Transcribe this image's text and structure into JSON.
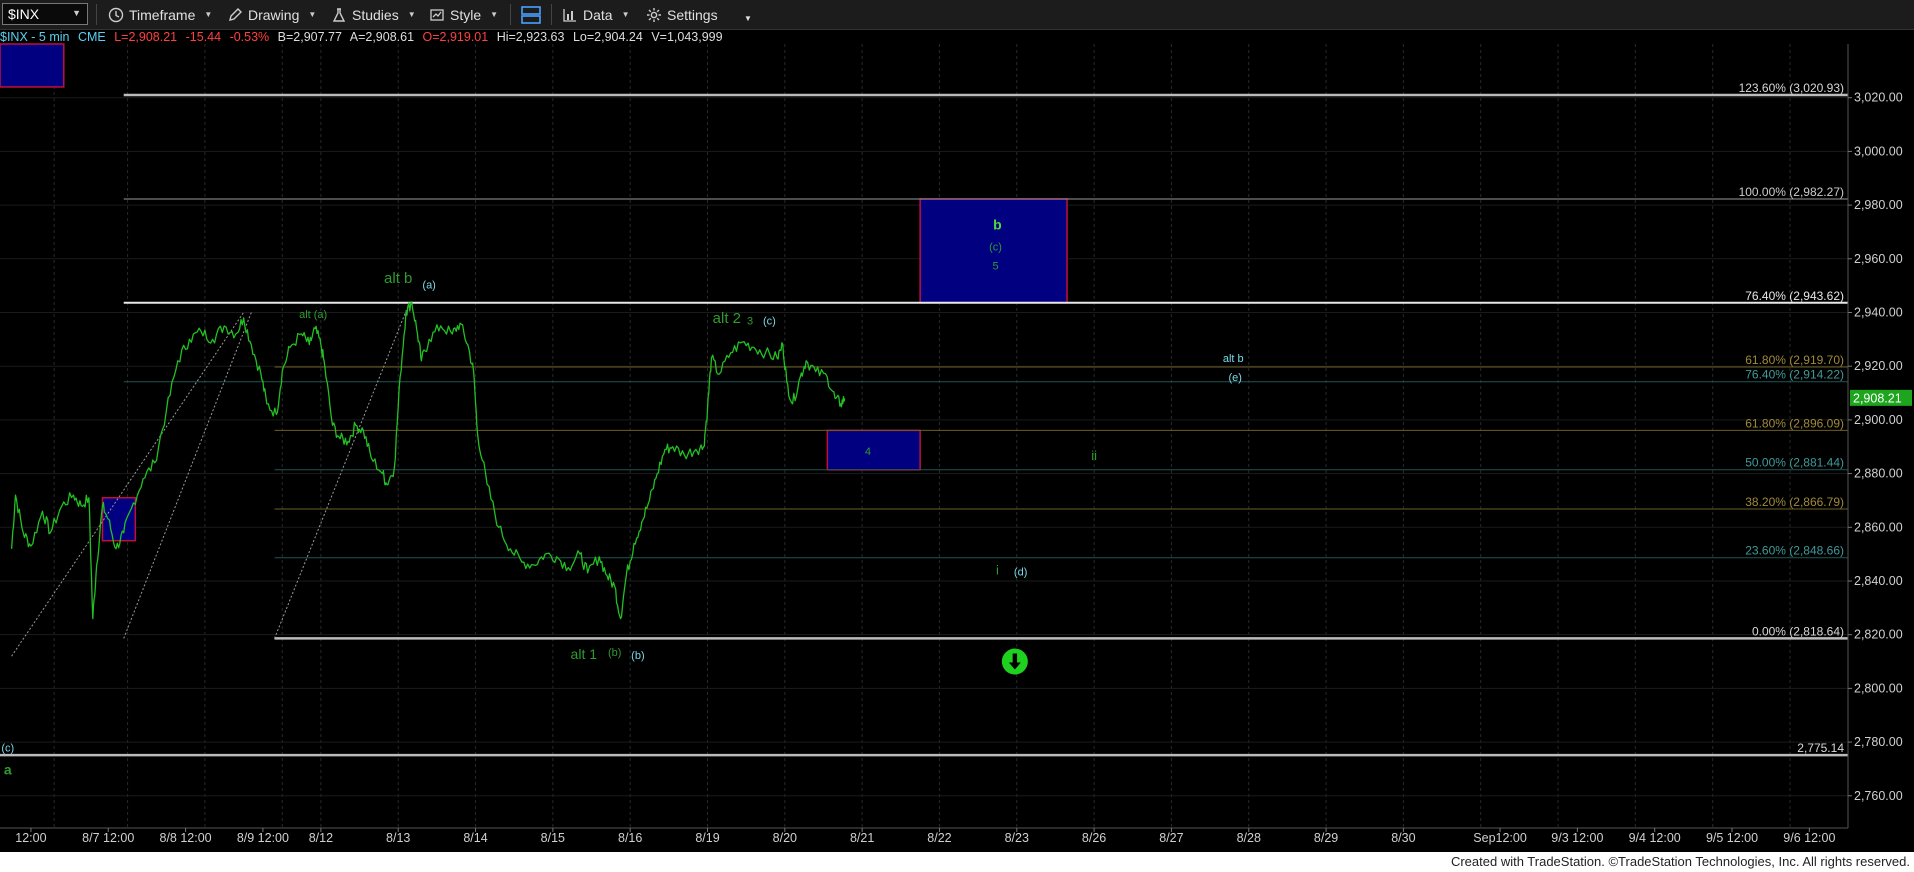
{
  "toolbar": {
    "symbol": "$INX",
    "timeframe_label": "Timeframe",
    "drawing_label": "Drawing",
    "studies_label": "Studies",
    "style_label": "Style",
    "data_label": "Data",
    "settings_label": "Settings"
  },
  "info": {
    "symbol_interval": "$INX - 5 min",
    "exchange": "CME",
    "last": "L=2,908.21",
    "change": "-15.44",
    "change_pct": "-0.53%",
    "bid": "B=2,907.77",
    "ask": "A=2,908.61",
    "open": "O=2,919.01",
    "high": "Hi=2,923.63",
    "low": "Lo=2,904.24",
    "volume": "V=1,043,999"
  },
  "colors": {
    "up": "#4ade3a",
    "down": "#ff3b3b",
    "price": "#22c022",
    "wave_green": "#2f9b2f",
    "wave_cyan": "#7ad8e8",
    "box_fill": "#000080",
    "box_border": "#c0103a",
    "fib_gold": "#a08a3a",
    "fib_teal": "#2a6a6a",
    "last_price_bg": "#1ea51e"
  },
  "chart_data": {
    "type": "line",
    "symbol": "$INX",
    "interval": "5 min",
    "ylim": [
      2748,
      3040
    ],
    "y_ticks": [
      "3,020.00",
      "3,000.00",
      "2,980.00",
      "2,960.00",
      "2,940.00",
      "2,920.00",
      "2,900.00",
      "2,880.00",
      "2,860.00",
      "2,840.00",
      "2,820.00",
      "2,800.00",
      "2,780.00",
      "2,760.00"
    ],
    "y_tick_values": [
      3020,
      3000,
      2980,
      2960,
      2940,
      2920,
      2900,
      2880,
      2860,
      2840,
      2820,
      2800,
      2780,
      2760
    ],
    "x_ticks": [
      "12:00",
      "8/7 12:00",
      "8/8 12:00",
      "8/9 12:00",
      "8/12",
      "8/13",
      "8/14",
      "8/15",
      "8/16",
      "8/19",
      "8/20",
      "8/21",
      "8/22",
      "8/23",
      "8/26",
      "8/27",
      "8/28",
      "8/29",
      "8/30",
      "Sep12:00",
      "9/3 12:00",
      "9/4 12:00",
      "9/5 12:00",
      "9/6 12:00"
    ],
    "x_tick_index": [
      0.5,
      2.5,
      4.5,
      6.5,
      8,
      10,
      12,
      14,
      16,
      18,
      20,
      22,
      24,
      26,
      28,
      30,
      32,
      34,
      36,
      38.5,
      40.5,
      42.5,
      44.5,
      46.5
    ],
    "x_range": [
      -0.3,
      47.5
    ],
    "session_starts": [
      1.1,
      3,
      5,
      7,
      8,
      10,
      12,
      14,
      16,
      18,
      20,
      22,
      24,
      26,
      28,
      30,
      32,
      34,
      36,
      38,
      40,
      42,
      44,
      46
    ],
    "series": [
      {
        "values": [
          [
            0.0,
            2852
          ],
          [
            0.1,
            2872
          ],
          [
            0.3,
            2858
          ],
          [
            0.5,
            2853
          ],
          [
            0.8,
            2866
          ],
          [
            1.0,
            2858
          ],
          [
            1.3,
            2868
          ],
          [
            1.6,
            2872
          ],
          [
            1.8,
            2868
          ],
          [
            2.0,
            2871
          ],
          [
            2.1,
            2826
          ],
          [
            2.2,
            2846
          ],
          [
            2.35,
            2868
          ],
          [
            2.5,
            2863
          ],
          [
            2.7,
            2852
          ],
          [
            2.9,
            2858
          ],
          [
            3.1,
            2867
          ],
          [
            3.4,
            2878
          ],
          [
            3.7,
            2884
          ],
          [
            4.0,
            2903
          ],
          [
            4.3,
            2922
          ],
          [
            4.6,
            2930
          ],
          [
            4.9,
            2933
          ],
          [
            5.2,
            2930
          ],
          [
            5.5,
            2935
          ],
          [
            5.8,
            2932
          ],
          [
            6.0,
            2938
          ],
          [
            6.2,
            2928
          ],
          [
            6.45,
            2917
          ],
          [
            6.6,
            2906
          ],
          [
            6.85,
            2902
          ],
          [
            7.0,
            2918
          ],
          [
            7.2,
            2927
          ],
          [
            7.5,
            2932
          ],
          [
            7.7,
            2928
          ],
          [
            7.85,
            2934
          ],
          [
            8.0,
            2928
          ],
          [
            8.1,
            2920
          ],
          [
            8.3,
            2898
          ],
          [
            8.5,
            2893
          ],
          [
            8.7,
            2892
          ],
          [
            8.9,
            2898
          ],
          [
            9.1,
            2896
          ],
          [
            9.3,
            2886
          ],
          [
            9.6,
            2880
          ],
          [
            9.7,
            2876
          ],
          [
            9.9,
            2882
          ],
          [
            10.05,
            2916
          ],
          [
            10.2,
            2940
          ],
          [
            10.35,
            2944
          ],
          [
            10.5,
            2932
          ],
          [
            10.6,
            2922
          ],
          [
            10.8,
            2930
          ],
          [
            11.1,
            2935
          ],
          [
            11.4,
            2932
          ],
          [
            11.6,
            2936
          ],
          [
            11.8,
            2928
          ],
          [
            11.95,
            2918
          ],
          [
            12.05,
            2895
          ],
          [
            12.3,
            2876
          ],
          [
            12.6,
            2860
          ],
          [
            12.9,
            2852
          ],
          [
            13.2,
            2847
          ],
          [
            13.5,
            2846
          ],
          [
            13.8,
            2850
          ],
          [
            14.1,
            2849
          ],
          [
            14.4,
            2845
          ],
          [
            14.7,
            2850
          ],
          [
            14.9,
            2843
          ],
          [
            15.2,
            2849
          ],
          [
            15.4,
            2842
          ],
          [
            15.6,
            2838
          ],
          [
            15.75,
            2826
          ],
          [
            15.9,
            2842
          ],
          [
            16.1,
            2854
          ],
          [
            16.3,
            2862
          ],
          [
            16.5,
            2870
          ],
          [
            16.7,
            2880
          ],
          [
            16.9,
            2889
          ],
          [
            17.1,
            2890
          ],
          [
            17.4,
            2887
          ],
          [
            17.7,
            2889
          ],
          [
            17.9,
            2890
          ],
          [
            18.0,
            2904
          ],
          [
            18.1,
            2923
          ],
          [
            18.3,
            2917
          ],
          [
            18.6,
            2925
          ],
          [
            18.9,
            2929
          ],
          [
            19.2,
            2927
          ],
          [
            19.5,
            2925
          ],
          [
            19.8,
            2923
          ],
          [
            19.95,
            2928
          ],
          [
            20.05,
            2914
          ],
          [
            20.2,
            2906
          ],
          [
            20.4,
            2916
          ],
          [
            20.55,
            2922
          ],
          [
            20.8,
            2918
          ],
          [
            21.1,
            2916
          ],
          [
            21.3,
            2908
          ],
          [
            21.45,
            2906
          ],
          [
            21.55,
            2908
          ]
        ]
      }
    ],
    "fib_levels": [
      {
        "label": "123.60% (3,020.93)",
        "value": 3021,
        "style": "major"
      },
      {
        "label": "100.00% (2,982.27)",
        "value": 2982.27,
        "style": "minor_gray"
      },
      {
        "label": "76.40% (2,943.62)",
        "value": 2943.62,
        "style": "major_white"
      },
      {
        "label": "61.80% (2,919.70)",
        "value": 2919.7,
        "style": "gold"
      },
      {
        "label": "76.40% (2,914.22)",
        "value": 2914.22,
        "style": "teal"
      },
      {
        "label": "61.80% (2,896.09)",
        "value": 2896.09,
        "style": "gold"
      },
      {
        "label": "50.00% (2,881.44)",
        "value": 2881.44,
        "style": "teal"
      },
      {
        "label": "38.20% (2,866.79)",
        "value": 2866.79,
        "style": "gold"
      },
      {
        "label": "23.60% (2,848.66)",
        "value": 2848.66,
        "style": "teal"
      },
      {
        "label": "0.00% (2,818.64)",
        "value": 2818.64,
        "style": "major"
      },
      {
        "label": "2,775.14",
        "value": 2775.14,
        "style": "major"
      }
    ],
    "fib_start_index": [
      2.9,
      2.9,
      2.9,
      6.8,
      2.9,
      6.8,
      6.8,
      6.8,
      6.8,
      6.8,
      -0.3
    ],
    "zones": [
      {
        "x": [
          23.5,
          27.3
        ],
        "y": [
          2943.6,
          2982.3
        ]
      },
      {
        "x": [
          21.1,
          23.5
        ],
        "y": [
          2881.4,
          2896.1
        ]
      },
      {
        "x": [
          2.35,
          3.2
        ],
        "y": [
          2855,
          2871
        ]
      },
      {
        "x": [
          -0.3,
          1.35
        ],
        "y": [
          3024,
          3040
        ]
      }
    ],
    "trendlines": [
      {
        "from": [
          0.0,
          2812
        ],
        "to": [
          6.0,
          2940
        ]
      },
      {
        "from": [
          2.9,
          2818.6
        ],
        "to": [
          6.2,
          2940
        ]
      },
      {
        "from": [
          6.8,
          2818.6
        ],
        "to": [
          10.3,
          2944
        ]
      }
    ],
    "annotations": [
      {
        "text": "alt b",
        "x": 10.0,
        "y": 2951,
        "color": "green",
        "size": 15
      },
      {
        "text": "(a)",
        "x": 10.8,
        "y": 2949,
        "color": "cyan",
        "size": 11
      },
      {
        "text": "alt (a)",
        "x": 7.8,
        "y": 2938,
        "color": "green",
        "size": 11
      },
      {
        "text": "alt 2",
        "x": 18.5,
        "y": 2936,
        "color": "green",
        "size": 15
      },
      {
        "text": "3",
        "x": 19.1,
        "y": 2935.5,
        "color": "green",
        "size": 11
      },
      {
        "text": "(c)",
        "x": 19.6,
        "y": 2935.5,
        "color": "cyan",
        "size": 11
      },
      {
        "text": "b",
        "x": 25.5,
        "y": 2971,
        "color": "green",
        "size": 14
      },
      {
        "text": "(c)",
        "x": 25.45,
        "y": 2963,
        "color": "green",
        "size": 11
      },
      {
        "text": "5",
        "x": 25.45,
        "y": 2956,
        "color": "green",
        "size": 11
      },
      {
        "text": "4",
        "x": 22.15,
        "y": 2887,
        "color": "green",
        "size": 11
      },
      {
        "text": "ii",
        "x": 28.0,
        "y": 2885,
        "color": "green",
        "size": 13
      },
      {
        "text": "alt b",
        "x": 31.6,
        "y": 2921.5,
        "color": "cyan",
        "size": 11
      },
      {
        "text": "(e)",
        "x": 31.65,
        "y": 2914.5,
        "color": "cyan",
        "size": 11
      },
      {
        "text": "i",
        "x": 25.5,
        "y": 2842.5,
        "color": "green",
        "size": 13
      },
      {
        "text": "(d)",
        "x": 26.1,
        "y": 2842,
        "color": "cyan",
        "size": 11
      },
      {
        "text": "alt 1",
        "x": 14.8,
        "y": 2811,
        "color": "green",
        "size": 14
      },
      {
        "text": "(b)",
        "x": 15.6,
        "y": 2812,
        "color": "green",
        "size": 11
      },
      {
        "text": "(b)",
        "x": 16.2,
        "y": 2811,
        "color": "cyan",
        "size": 11
      },
      {
        "text": "(c)",
        "x": -0.1,
        "y": 2776.5,
        "color": "cyan",
        "size": 11
      },
      {
        "text": "a",
        "x": -0.1,
        "y": 2768,
        "color": "green",
        "size": 14
      }
    ],
    "arrow": {
      "x": 25.95,
      "y": 2810,
      "direction": "down"
    },
    "last_price": {
      "label": "2,908.21",
      "value": 2908.21
    }
  },
  "footer": {
    "text": "Created with TradeStation. ©TradeStation Technologies, Inc. All rights reserved."
  }
}
